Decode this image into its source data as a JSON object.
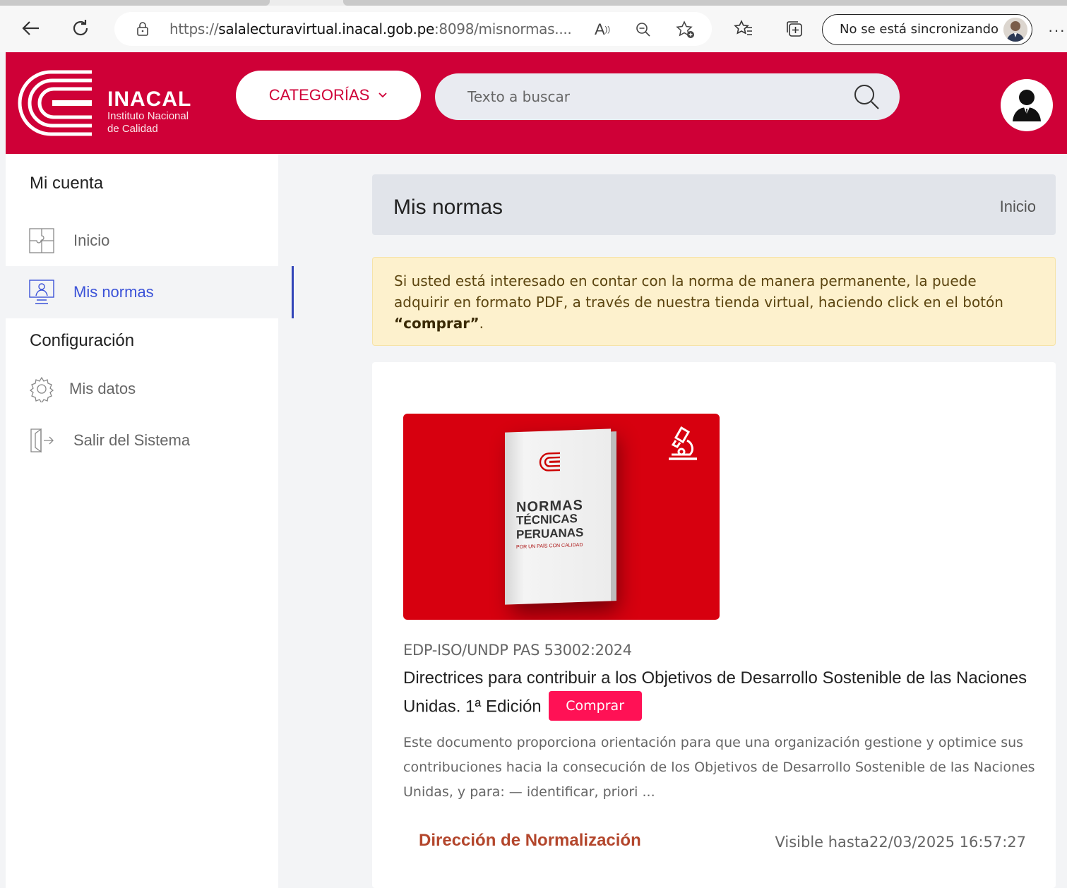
{
  "browser": {
    "url_scheme": "https://",
    "url_domain": "salalecturavirtual.inacal.gob.pe",
    "url_rest": ":8098/misnormas....",
    "sync_label": "No se está sincronizando",
    "more_label": "···"
  },
  "header": {
    "brand": "INACAL",
    "brand_sub1": "Instituto Nacional",
    "brand_sub2": "de Calidad",
    "categories_label": "CATEGORÍAS",
    "search_placeholder": "Texto a buscar",
    "accent_color": "#cf0037"
  },
  "sidebar": {
    "account_title": "Mi cuenta",
    "items": [
      {
        "label": "Inicio",
        "icon": "puzzle-icon"
      },
      {
        "label": "Mis normas",
        "icon": "monitor-user-icon",
        "active": true
      }
    ],
    "config_title": "Configuración",
    "config_items": [
      {
        "label": "Mis datos",
        "icon": "gear-icon"
      },
      {
        "label": "Salir del Sistema",
        "icon": "logout-icon"
      }
    ]
  },
  "main": {
    "page_title": "Mis normas",
    "breadcrumb": "Inicio",
    "notice_text_1": "Si usted está interesado en contar con la norma de manera permanente, la puede adquirir en formato PDF, a través de nuestra tienda virtual, haciendo click en el botón ",
    "notice_bold": "“comprar”",
    "notice_end": ".",
    "cover": {
      "line1": "NORMAS",
      "line2": "TÉCNICAS",
      "line3": "PERUANAS",
      "line4": "POR UN PAÍS CON CALIDAD"
    },
    "doc": {
      "code": "EDP-ISO/UNDP PAS 53002:2024",
      "title": "Directrices para contribuir a los Objetivos de Desarrollo Sostenible de las Naciones Unidas. 1ª Edición",
      "buy_label": "Comprar",
      "description": "Este documento proporciona orientación para que una organización gestione y optimice sus contribuciones hacia la consecución de los Objetivos de Desarrollo Sostenible de las Naciones Unidas, y para: — identificar, priori ...",
      "department": "Dirección de Normalización",
      "visible_until": "Visible hasta22/03/2025 16:57:27"
    }
  }
}
